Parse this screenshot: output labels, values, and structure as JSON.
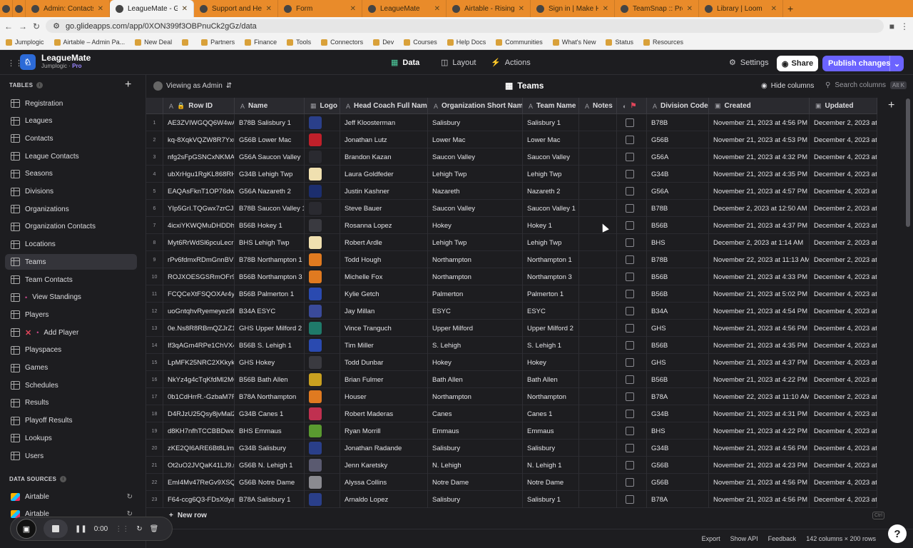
{
  "browser": {
    "tabs": [
      {
        "title": "",
        "icon": "record-dot-icon"
      },
      {
        "title": "",
        "icon": "bookmark-icon"
      },
      {
        "title": "Admin: Contacts - A",
        "icon": "ad-icon"
      },
      {
        "title": "LeagueMate - G",
        "icon": "glide-icon",
        "active": true
      },
      {
        "title": "Support and Help R",
        "icon": "glide-icon"
      },
      {
        "title": "Form",
        "icon": "form-icon"
      },
      {
        "title": "LeagueMate",
        "icon": "globe-icon"
      },
      {
        "title": "Airtable - Rising",
        "icon": "airtable-icon"
      },
      {
        "title": "Sign in | Make HQ",
        "icon": "make-icon"
      },
      {
        "title": "TeamSnap :: Premi",
        "icon": "teamsnap-icon"
      },
      {
        "title": "Library | Loom",
        "icon": "loom-icon"
      }
    ],
    "url": "go.glideapps.com/app/0XON399f3OBPnuCk2gGz/data",
    "bookmarks": [
      "Jumplogic",
      "Airtable – Admin Pa...",
      "New Deal",
      "",
      "Partners",
      "Finance",
      "Tools",
      "Connectors",
      "Dev",
      "Courses",
      "Help Docs",
      "Communities",
      "What's New",
      "Status",
      "Resources"
    ]
  },
  "app": {
    "name": "LeagueMate",
    "org": "Jumplogic",
    "plan": "Pro",
    "nav": {
      "data": "Data",
      "layout": "Layout",
      "actions": "Actions"
    },
    "settings": "Settings",
    "share": "Share",
    "publish": "Publish changes"
  },
  "sidebar": {
    "tables_label": "TABLES",
    "items": [
      {
        "label": "Registration"
      },
      {
        "label": "Leagues"
      },
      {
        "label": "Contacts"
      },
      {
        "label": "League Contacts"
      },
      {
        "label": "Seasons"
      },
      {
        "label": "Divisions"
      },
      {
        "label": "Organizations"
      },
      {
        "label": "Organization Contacts"
      },
      {
        "label": "Locations"
      },
      {
        "label": "Teams",
        "active": true
      },
      {
        "label": "Team Contacts"
      },
      {
        "label": "View Standings"
      },
      {
        "label": "Players"
      },
      {
        "label": "Add Player"
      },
      {
        "label": "Playspaces"
      },
      {
        "label": "Games"
      },
      {
        "label": "Schedules"
      },
      {
        "label": "Results"
      },
      {
        "label": "Playoff Results"
      },
      {
        "label": "Lookups"
      },
      {
        "label": "Users"
      }
    ],
    "data_sources_label": "DATA SOURCES",
    "sources": [
      {
        "label": "Airtable"
      },
      {
        "label": "Airtable"
      }
    ]
  },
  "grid": {
    "viewing_as": "Viewing as Admin",
    "table_title": "Teams",
    "hide_columns": "Hide columns",
    "search_placeholder": "Search columns",
    "search_shortcut": "Alt K",
    "columns": [
      "Row ID",
      "Name",
      "Logo",
      "Head Coach Full Name",
      "Organization Short Name",
      "Team Name",
      "Notes",
      "",
      "Division Code",
      "Created",
      "Updated"
    ],
    "rows": [
      [
        "1",
        "AE3ZVIWGQQ6W4wAl",
        "B78B Salisbury 1",
        "#2a3f8a",
        "Jeff Kloosterman",
        "Salisbury",
        "Salisbury 1",
        "",
        "B78B",
        "November 21, 2023 at 4:56 PM",
        "December 2, 2023 at"
      ],
      [
        "2",
        "kq-8XqkVQZW8R7Yxu",
        "G56B Lower Mac",
        "#c0202a",
        "Jonathan Lutz",
        "Lower Mac",
        "Lower Mac",
        "",
        "G56B",
        "November 21, 2023 at 4:53 PM",
        "December 4, 2023 at"
      ],
      [
        "3",
        "nfg2sFpGSNCxNKMA7",
        "G56A Saucon Valley",
        "#2a2a30",
        "Brandon Kazan",
        "Saucon Valley",
        "Saucon Valley",
        "",
        "G56A",
        "November 21, 2023 at 4:32 PM",
        "December 4, 2023 at"
      ],
      [
        "4",
        "ubXrHgu1RgKL868RHv",
        "G34B Lehigh Twp",
        "#f0e0b0",
        "Laura Goldfeder",
        "Lehigh Twp",
        "Lehigh Twp",
        "",
        "G34B",
        "November 21, 2023 at 4:35 PM",
        "December 4, 2023 at"
      ],
      [
        "5",
        "EAQAsFknT1OP76dwp",
        "G56A Nazareth 2",
        "#1c2e6e",
        "Justin Kashner",
        "Nazareth",
        "Nazareth 2",
        "",
        "G56A",
        "November 21, 2023 at 4:57 PM",
        "December 4, 2023 at"
      ],
      [
        "6",
        "YIp5GrI.TQGwx7zrCJL",
        "B78B Saucon Valley 1",
        "#2a2a30",
        "Steve Bauer",
        "Saucon Valley",
        "Saucon Valley 1",
        "",
        "B78B",
        "December 2, 2023 at 12:50 AM",
        "December 2, 2023 at"
      ],
      [
        "7",
        "4icxiYKWQMuDHDDhE",
        "B56B Hokey 1",
        "#3a3a40",
        "Rosanna Lopez",
        "Hokey",
        "Hokey 1",
        "",
        "B56B",
        "November 21, 2023 at 4:37 PM",
        "December 4, 2023 at"
      ],
      [
        "8",
        "Myt6RrWdSl6pcuLecr!",
        "BHS Lehigh Twp",
        "#f0e0b0",
        "Robert Ardle",
        "Lehigh Twp",
        "Lehigh Twp",
        "",
        "BHS",
        "December 2, 2023 at 1:14 AM",
        "December 2, 2023 at"
      ],
      [
        "9",
        "rPv6fdmxRDmGnnBV1",
        "B78B Northampton 1",
        "#e07a20",
        "Todd Hough",
        "Northampton",
        "Northampton 1",
        "",
        "B78B",
        "November 22, 2023 at 11:13 AM",
        "December 2, 2023 at"
      ],
      [
        "10",
        "ROJXOESGSRmOFr9lg",
        "B56B Northampton 3",
        "#e07a20",
        "Michelle Fox",
        "Northampton",
        "Northampton 3",
        "",
        "B56B",
        "November 21, 2023 at 4:33 PM",
        "December 4, 2023 at"
      ],
      [
        "11",
        "FCQCeXtFSQOXAr4yT",
        "B56B Palmerton 1",
        "#2a4ab0",
        "Kylie Getch",
        "Palmerton",
        "Palmerton 1",
        "",
        "B56B",
        "November 21, 2023 at 5:02 PM",
        "December 4, 2023 at"
      ],
      [
        "12",
        "uoGntqhvRyemeyez9K",
        "B34A ESYC",
        "#3a4a9a",
        "Jay Millan",
        "ESYC",
        "ESYC",
        "",
        "B34A",
        "November 21, 2023 at 4:54 PM",
        "December 4, 2023 at"
      ],
      [
        "13",
        "0e.Ns8R8RBmQZJrZ16",
        "GHS Upper Milford 2",
        "#1f7a6a",
        "Vince Tranguch",
        "Upper Milford",
        "Upper Milford 2",
        "",
        "GHS",
        "November 21, 2023 at 4:56 PM",
        "December 4, 2023 at"
      ],
      [
        "14",
        "If3qAGm4RPe1ChVX4l",
        "B56B S. Lehigh 1",
        "#2a4ab0",
        "Tim Miller",
        "S. Lehigh",
        "S. Lehigh 1",
        "",
        "B56B",
        "November 21, 2023 at 4:35 PM",
        "December 4, 2023 at"
      ],
      [
        "15",
        "LpMFK25NRC2XKkykJ",
        "GHS Hokey",
        "#3a3a40",
        "Todd Dunbar",
        "Hokey",
        "Hokey",
        "",
        "GHS",
        "November 21, 2023 at 4:37 PM",
        "December 4, 2023 at"
      ],
      [
        "16",
        "NkYz4g4cTqKfdMl2MC",
        "B56B Bath Allen",
        "#c9a020",
        "Brian Fulmer",
        "Bath Allen",
        "Bath Allen",
        "",
        "B56B",
        "November 21, 2023 at 4:22 PM",
        "December 4, 2023 at"
      ],
      [
        "17",
        "0b1CdHrrR.-GzbaM7Fi",
        "B78A Northampton",
        "#e07a20",
        "Houser",
        "Northampton",
        "Northampton",
        "",
        "B78A",
        "November 22, 2023 at 11:10 AM",
        "December 2, 2023 at"
      ],
      [
        "18",
        "D4RJzU25Qsy8jvMal2",
        "G34B Canes 1",
        "#c03050",
        "Robert Maderas",
        "Canes",
        "Canes 1",
        "",
        "G34B",
        "November 21, 2023 at 4:31 PM",
        "December 4, 2023 at"
      ],
      [
        "19",
        "d8KH7nfhTCCBBDwxY",
        "BHS Emmaus",
        "#5a9a30",
        "Ryan Morrill",
        "Emmaus",
        "Emmaus",
        "",
        "BHS",
        "November 21, 2023 at 4:22 PM",
        "December 4, 2023 at"
      ],
      [
        "20",
        "zKE2QI6ARE6Bt8Llrna",
        "G34B Salisbury",
        "#2a3f8a",
        "Jonathan Radande",
        "Salisbury",
        "Salisbury",
        "",
        "G34B",
        "November 21, 2023 at 4:56 PM",
        "December 4, 2023 at"
      ],
      [
        "21",
        "Ot2uO2JVQaK41LJ9.m",
        "G56B N. Lehigh 1",
        "#5a5a70",
        "Jenn Karetsky",
        "N. Lehigh",
        "N. Lehigh 1",
        "",
        "G56B",
        "November 21, 2023 at 4:23 PM",
        "December 4, 2023 at"
      ],
      [
        "22",
        "EmI4Mv47ReGv9XSQc",
        "G56B Notre Dame",
        "#8a8a90",
        "Alyssa Collins",
        "Notre Dame",
        "Notre Dame",
        "",
        "G56B",
        "November 21, 2023 at 4:56 PM",
        "December 4, 2023 at"
      ],
      [
        "23",
        "F64-ccg6Q3-FDsXdya",
        "B78A Salisbury 1",
        "#2a3f8a",
        "Arnaldo Lopez",
        "Salisbury",
        "Salisbury 1",
        "",
        "B78A",
        "November 21, 2023 at 4:56 PM",
        "December 4, 2023 at"
      ]
    ],
    "new_row": "New row",
    "shortcut_hint": "Ctrl"
  },
  "footer": {
    "export": "Export",
    "show_api": "Show API",
    "feedback": "Feedback",
    "counts": "142 columns × 200 rows",
    "help": "?"
  },
  "recorder": {
    "time": "0:00"
  }
}
